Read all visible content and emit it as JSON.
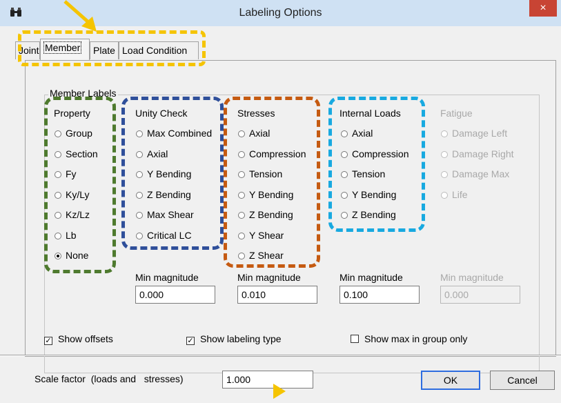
{
  "window": {
    "title": "Labeling Options",
    "close_glyph": "×",
    "icon": "binoculars-icon"
  },
  "tabs": [
    "Joint",
    "Member",
    "Plate",
    "Load Condition"
  ],
  "active_tab": "Member",
  "member_labels": {
    "title": "Member Labels",
    "property": {
      "title": "Property",
      "options": [
        "Group",
        "Section",
        "Fy",
        "Ky/Ly",
        "Kz/Lz",
        "Lb",
        "None"
      ],
      "selected": "None"
    },
    "unity_check": {
      "title": "Unity Check",
      "options": [
        "Max Combined",
        "Axial",
        "Y Bending",
        "Z Bending",
        "Max Shear",
        "Critical LC"
      ]
    },
    "stresses": {
      "title": "Stresses",
      "options": [
        "Axial",
        "Compression",
        "Tension",
        "Y Bending",
        "Z Bending",
        "Y Shear",
        "Z Shear"
      ]
    },
    "internal_loads": {
      "title": "Internal Loads",
      "options": [
        "Axial",
        "Compression",
        "Tension",
        "Y Bending",
        "Z Bending"
      ]
    },
    "fatigue": {
      "title": "Fatigue",
      "options": [
        "Damage Left",
        "Damage Right",
        "Damage Max",
        "Life"
      ]
    },
    "min_magnitude_label": "Min magnitude",
    "min_magnitude": {
      "unity_check": "0.000",
      "stresses": "0.010",
      "internal_loads": "0.100",
      "fatigue": "0.000"
    }
  },
  "checkboxes": {
    "show_offsets": {
      "label": "Show offsets",
      "checked": true
    },
    "show_labeling_type": {
      "label": "Show labeling type",
      "checked": true
    },
    "show_max_in_group_only": {
      "label": "Show max in group only",
      "checked": false
    }
  },
  "check_mark": "✓",
  "scale_factor": {
    "label": "Scale factor  (loads and   stresses)",
    "value": "1.000"
  },
  "buttons": {
    "ok": "OK",
    "cancel": "Cancel"
  },
  "highlight_colors": {
    "tabs": "#f5c400",
    "property": "#4e7a2e",
    "unity_check": "#2f4f9a",
    "stresses": "#c55a11",
    "internal_loads": "#18a9e0",
    "arrows": "#f5c400"
  }
}
